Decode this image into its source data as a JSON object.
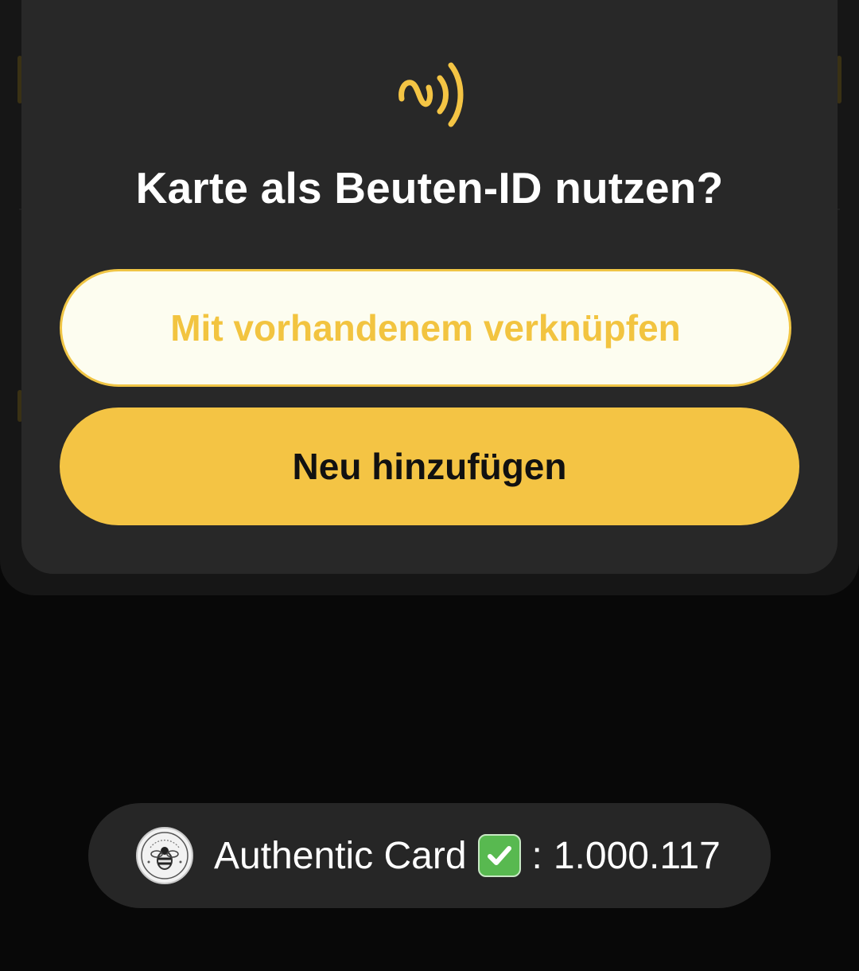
{
  "dialog": {
    "icon": "nfc-icon",
    "title": "Karte als Beuten-ID nutzen?",
    "link_existing_label": "Mit vorhandenem verknüpfen",
    "add_new_label": "Neu hinzufügen"
  },
  "toast": {
    "avatar_icon": "bee-logo-icon",
    "label": "Authentic Card",
    "status_icon": "check-mark-button-icon",
    "separator": ":",
    "value": "1.000.117"
  },
  "colors": {
    "accent": "#f4c444",
    "dialog_bg": "#282828",
    "background": "#080808",
    "toast_bg": "#262626",
    "link_button_bg": "#fdfdf0"
  }
}
